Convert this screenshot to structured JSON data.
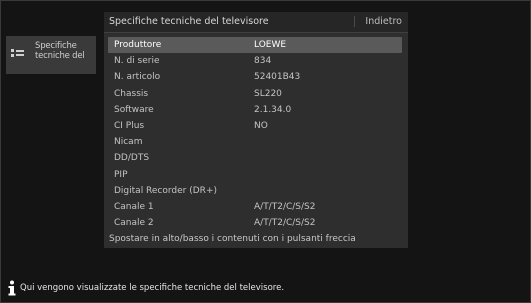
{
  "side_menu": {
    "item_label": "Specifiche tecniche del",
    "icon": "list-icon"
  },
  "panel": {
    "title": "Specifiche tecniche del televisore",
    "back_label": "Indietro",
    "hint": "Spostare in alto/basso i contenuti con i pulsanti freccia"
  },
  "rows": [
    {
      "label": "Produttore",
      "value": "LOEWE"
    },
    {
      "label": "N. di serie",
      "value": "834"
    },
    {
      "label": "N. articolo",
      "value": "52401B43"
    },
    {
      "label": "Chassis",
      "value": "SL220"
    },
    {
      "label": "Software",
      "value": "2.1.34.0"
    },
    {
      "label": "CI Plus",
      "value": "NO"
    },
    {
      "label": "Nicam",
      "value": ""
    },
    {
      "label": "DD/DTS",
      "value": ""
    },
    {
      "label": "PIP",
      "value": ""
    },
    {
      "label": "Digital Recorder (DR+)",
      "value": ""
    },
    {
      "label": "Canale 1",
      "value": "A/T/T2/C/S/S2"
    },
    {
      "label": "Canale 2",
      "value": "A/T/T2/C/S/S2"
    }
  ],
  "selected_row_index": 0,
  "info": {
    "icon": "info-icon",
    "text": "Qui vengono visualizzate le specifiche tecniche del televisore."
  },
  "colors": {
    "background": "#141414",
    "panel": "#2e2e2e",
    "selection": "#5a5a5a"
  }
}
